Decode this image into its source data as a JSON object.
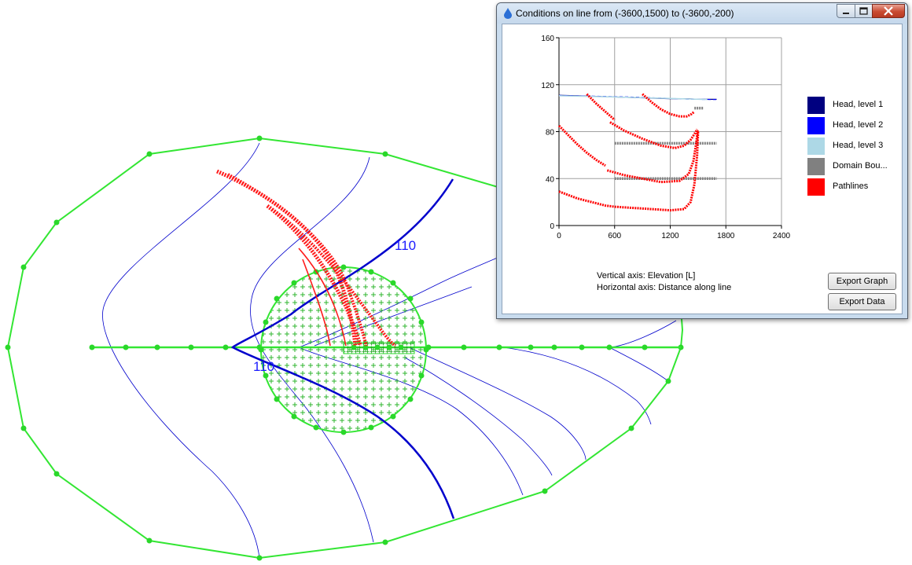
{
  "map": {
    "contour_label_top": "110",
    "contour_label_bottom": "110",
    "colors": {
      "domain_boundary": "#33e633",
      "head_contour": "#0000cc",
      "pathline": "#ff1a1a"
    }
  },
  "window": {
    "title": "Conditions on line from (-3600,1500) to (-3600,-200)",
    "title_icon": "water-drop-icon",
    "controls": [
      "minimize-icon",
      "maximize-icon",
      "close-icon"
    ]
  },
  "chart_data": {
    "type": "scatter",
    "xlim": [
      0,
      2400
    ],
    "ylim": [
      0,
      160
    ],
    "x_ticks": [
      "0",
      "600",
      "1200",
      "1800",
      "2400"
    ],
    "y_ticks": [
      "0",
      "40",
      "80",
      "120",
      "160"
    ],
    "grid": true,
    "legend_position": "right",
    "xlabel": "Horizontal axis: Distance along line",
    "ylabel": "Vertical axis: Elevation [L]",
    "series": [
      {
        "name": "Head, level 1",
        "color": "#000080",
        "x": [
          0,
          200,
          400,
          600,
          800,
          1000,
          1200,
          1400,
          1500,
          1600,
          1700
        ],
        "y": [
          111,
          110.5,
          110,
          109.5,
          109,
          108.5,
          108,
          108,
          107.5,
          107.5,
          107.5
        ]
      },
      {
        "name": "Head, level 2",
        "color": "#0000ff",
        "x": [
          0,
          300,
          600,
          850,
          1350,
          1500,
          1700
        ],
        "y": [
          110.8,
          110.3,
          109.8,
          109.3,
          107.8,
          107.5,
          107.3
        ]
      },
      {
        "name": "Head, level 3",
        "color": "#add8e6",
        "x": [
          0,
          600,
          1000,
          1200,
          1400,
          1600
        ],
        "y": [
          110.5,
          109.5,
          108.7,
          108.3,
          107.8,
          107.4
        ]
      },
      {
        "name": "Domain Bou...",
        "color": "#808080",
        "segments": [
          {
            "x": [
              600,
              1700
            ],
            "y": [
              40,
              40
            ]
          },
          {
            "x": [
              600,
              1700
            ],
            "y": [
              70,
              70
            ]
          },
          {
            "x": [
              1460,
              1560
            ],
            "y": [
              100,
              100
            ]
          }
        ]
      },
      {
        "name": "Pathlines",
        "color": "#ff0000",
        "lines": [
          {
            "x": [
              0,
              200,
              400,
              500,
              600,
              800,
              1000,
              1200,
              1350,
              1420,
              1460,
              1490,
              1500
            ],
            "y": [
              29,
              23,
              19,
              17,
              16,
              15,
              14,
              13,
              14,
              20,
              35,
              60,
              80
            ]
          },
          {
            "x": [
              520,
              700,
              900,
              1100,
              1300,
              1400,
              1450,
              1480,
              1495
            ],
            "y": [
              47,
              43,
              40,
              37,
              38,
              44,
              55,
              70,
              81
            ]
          },
          {
            "x": [
              0,
              100,
              200,
              300,
              400,
              500
            ],
            "y": [
              85,
              77,
              69,
              62,
              56,
              51
            ]
          },
          {
            "x": [
              550,
              700,
              900,
              1100,
              1250,
              1350,
              1420,
              1470,
              1490
            ],
            "y": [
              88,
              81,
              74,
              68,
              66,
              68,
              73,
              79,
              82
            ]
          },
          {
            "x": [
              300,
              400,
              500,
              600
            ],
            "y": [
              112,
              104,
              97,
              90
            ]
          },
          {
            "x": [
              900,
              1000,
              1100,
              1200,
              1300,
              1380,
              1430,
              1460
            ],
            "y": [
              112,
              105,
              99,
              95,
              93,
              93,
              95,
              97
            ]
          }
        ]
      }
    ]
  },
  "legend": [
    {
      "label": "Head, level 1",
      "color": "#000080"
    },
    {
      "label": "Head, level 2",
      "color": "#0000ff"
    },
    {
      "label": "Head, level 3",
      "color": "#add8e6"
    },
    {
      "label": "Domain Bou...",
      "color": "#808080"
    },
    {
      "label": "Pathlines",
      "color": "#ff0000"
    }
  ],
  "captions": {
    "vertical": "Vertical axis: Elevation [L]",
    "horizontal": "Horizontal axis: Distance along line"
  },
  "buttons": {
    "export_graph": "Export Graph",
    "export_data": "Export Data"
  }
}
